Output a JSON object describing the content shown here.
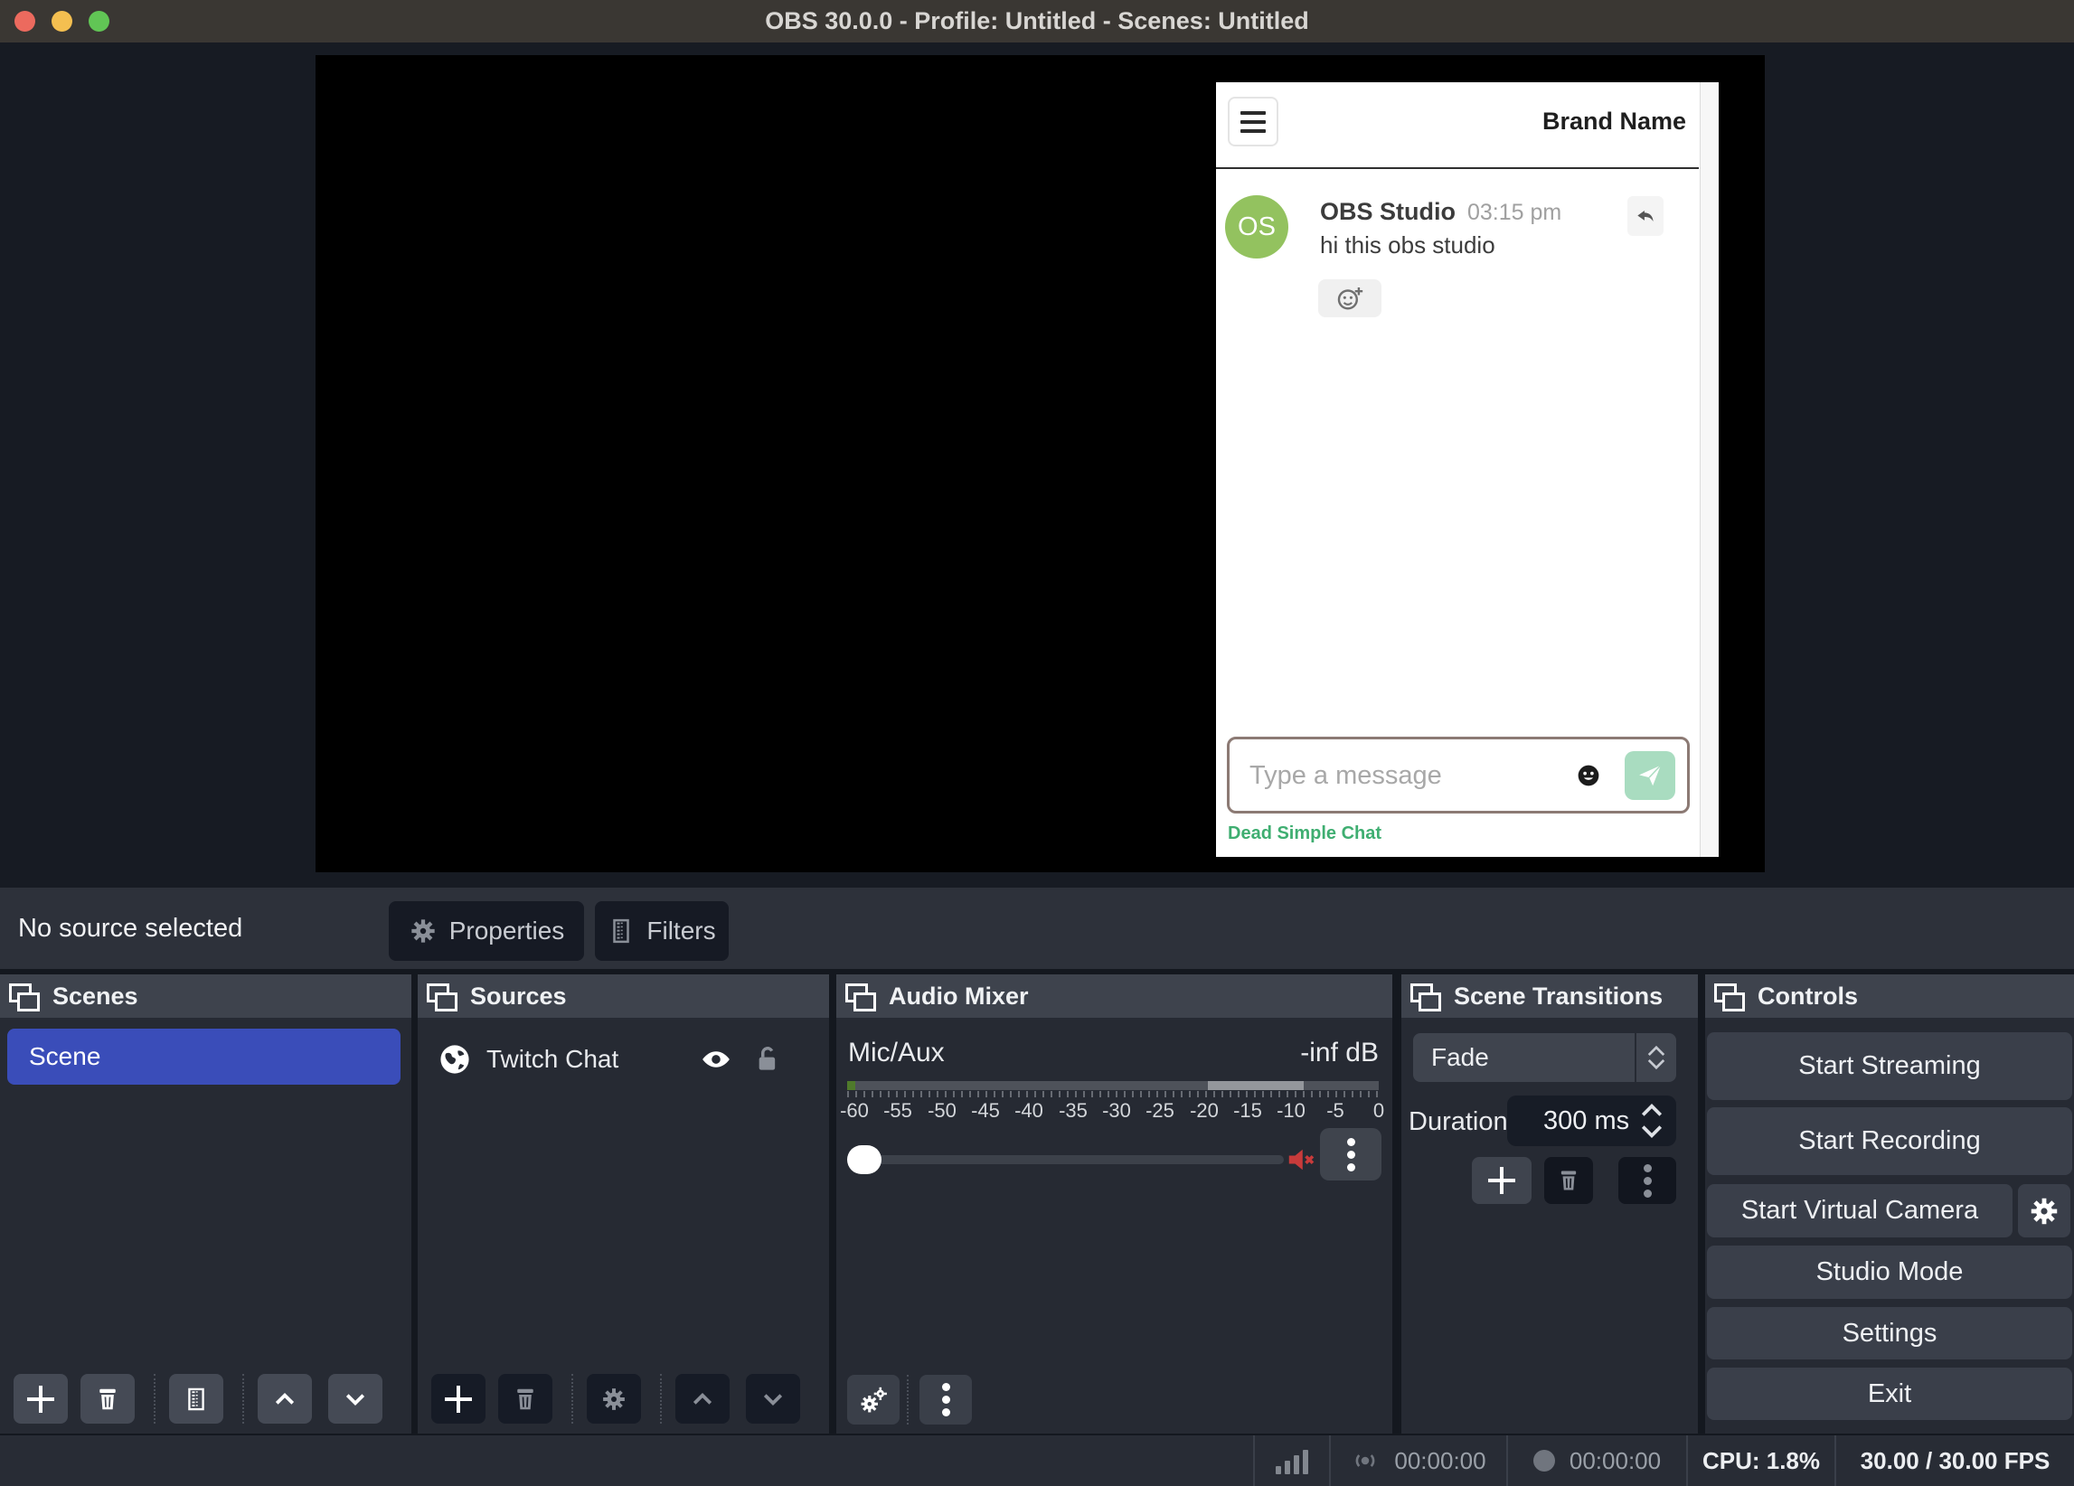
{
  "window": {
    "title": "OBS 30.0.0 - Profile: Untitled - Scenes: Untitled"
  },
  "chat_widget": {
    "brand": "Brand Name",
    "message": {
      "avatar_initials": "OS",
      "author": "OBS Studio",
      "time": "03:15 pm",
      "text": "hi this obs studio"
    },
    "input_placeholder": "Type a message",
    "footer_link": "Dead Simple Chat"
  },
  "toolbar": {
    "status": "No source selected",
    "properties_label": "Properties",
    "filters_label": "Filters"
  },
  "docks": {
    "scenes": {
      "title": "Scenes",
      "items": [
        {
          "label": "Scene",
          "selected": true
        }
      ]
    },
    "sources": {
      "title": "Sources",
      "items": [
        {
          "label": "Twitch Chat",
          "visible": true,
          "locked": false
        }
      ]
    },
    "audio_mixer": {
      "title": "Audio Mixer",
      "channel": "Mic/Aux",
      "level": "-inf dB",
      "ticks": [
        "-60",
        "-55",
        "-50",
        "-45",
        "-40",
        "-35",
        "-30",
        "-25",
        "-20",
        "-15",
        "-10",
        "-5",
        "0"
      ]
    },
    "scene_transitions": {
      "title": "Scene Transitions",
      "transition": "Fade",
      "duration_label": "Duration",
      "duration_value": "300 ms"
    },
    "controls": {
      "title": "Controls",
      "buttons": [
        "Start Streaming",
        "Start Recording",
        "Start Virtual Camera",
        "Studio Mode",
        "Settings",
        "Exit"
      ]
    }
  },
  "status_bar": {
    "stream_time": "00:00:00",
    "record_time": "00:00:00",
    "cpu": "CPU: 1.8%",
    "fps": "30.00 / 30.00 FPS"
  },
  "colors": {
    "titlebar": "#3a3733",
    "preview_bg": "#171b23",
    "dock_bg": "#262a33",
    "dock_header": "#3e434d",
    "selected_scene_blue": "#3a4db9",
    "button_dark": "#161a24",
    "button_gray": "#3a3f4a",
    "mute_red": "#c83b3b",
    "avatar_green": "#93c25f",
    "send_green": "#a9dcc0",
    "footer_link_green": "#3fae71",
    "meter_green": "#4f7a2b"
  }
}
